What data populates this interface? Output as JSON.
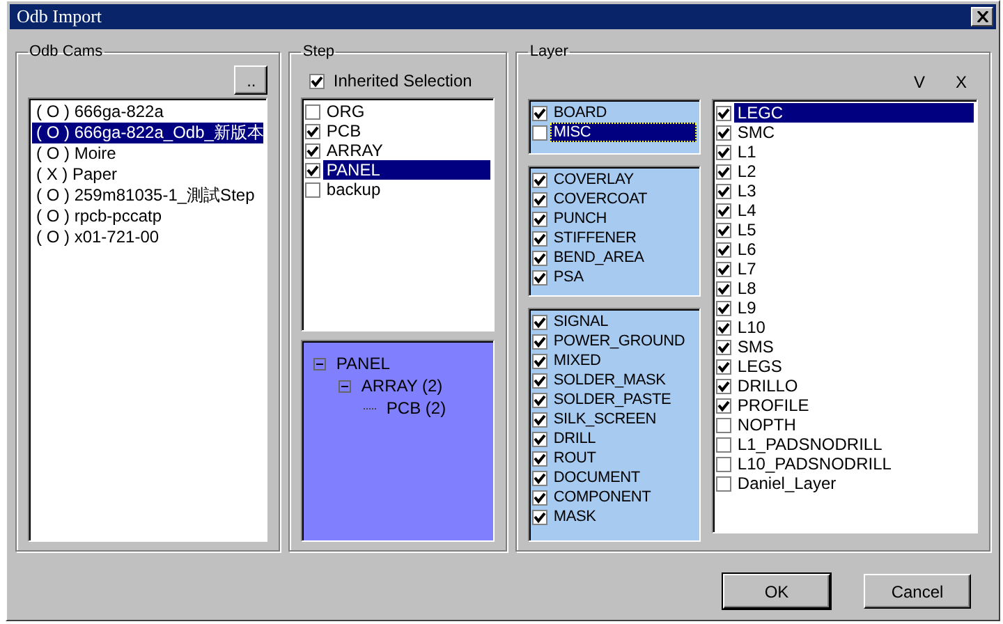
{
  "window": {
    "title": "Odb Import"
  },
  "odb_cams": {
    "title": "Odb Cams",
    "browse_button": "..",
    "items": [
      {
        "label": "( O ) 666ga-822a",
        "selected": false
      },
      {
        "label": "( O ) 666ga-822a_Odb_新版本",
        "selected": true
      },
      {
        "label": "( O ) Moire",
        "selected": false
      },
      {
        "label": "( X ) Paper",
        "selected": false
      },
      {
        "label": "( O ) 259m81035-1_測試Step",
        "selected": false
      },
      {
        "label": "( O ) rpcb-pccatp",
        "selected": false
      },
      {
        "label": "( O ) x01-721-00",
        "selected": false
      }
    ]
  },
  "step": {
    "title": "Step",
    "inherited_selection": {
      "label": "Inherited Selection",
      "checked": true
    },
    "items": [
      {
        "label": "ORG",
        "checked": false,
        "selected": false
      },
      {
        "label": "PCB",
        "checked": true,
        "selected": false
      },
      {
        "label": "ARRAY",
        "checked": true,
        "selected": false
      },
      {
        "label": "PANEL",
        "checked": true,
        "selected": true
      },
      {
        "label": "backup",
        "checked": false,
        "selected": false
      }
    ],
    "tree": [
      {
        "label": "PANEL",
        "expanded": true,
        "children": [
          {
            "label": "ARRAY (2)",
            "expanded": true,
            "children": [
              {
                "label": "PCB (2)"
              }
            ]
          }
        ]
      }
    ]
  },
  "layer": {
    "title": "Layer",
    "column_v": "V",
    "column_x": "X",
    "groups": [
      {
        "items": [
          {
            "label": "BOARD",
            "checked": true,
            "selected": false
          },
          {
            "label": "MISC",
            "checked": false,
            "selected": true
          }
        ]
      },
      {
        "items": [
          {
            "label": "COVERLAY",
            "checked": true,
            "selected": false
          },
          {
            "label": "COVERCOAT",
            "checked": true,
            "selected": false
          },
          {
            "label": "PUNCH",
            "checked": true,
            "selected": false
          },
          {
            "label": "STIFFENER",
            "checked": true,
            "selected": false
          },
          {
            "label": "BEND_AREA",
            "checked": true,
            "selected": false
          },
          {
            "label": "PSA",
            "checked": true,
            "selected": false
          }
        ]
      },
      {
        "items": [
          {
            "label": "SIGNAL",
            "checked": true,
            "selected": false
          },
          {
            "label": "POWER_GROUND",
            "checked": true,
            "selected": false
          },
          {
            "label": "MIXED",
            "checked": true,
            "selected": false
          },
          {
            "label": "SOLDER_MASK",
            "checked": true,
            "selected": false
          },
          {
            "label": "SOLDER_PASTE",
            "checked": true,
            "selected": false
          },
          {
            "label": "SILK_SCREEN",
            "checked": true,
            "selected": false
          },
          {
            "label": "DRILL",
            "checked": true,
            "selected": false
          },
          {
            "label": "ROUT",
            "checked": true,
            "selected": false
          },
          {
            "label": "DOCUMENT",
            "checked": true,
            "selected": false
          },
          {
            "label": "COMPONENT",
            "checked": true,
            "selected": false
          },
          {
            "label": "MASK",
            "checked": true,
            "selected": false
          }
        ]
      }
    ],
    "layers": [
      {
        "label": "LEGC",
        "checked": true,
        "selected": true
      },
      {
        "label": "SMC",
        "checked": true,
        "selected": false
      },
      {
        "label": "L1",
        "checked": true,
        "selected": false
      },
      {
        "label": "L2",
        "checked": true,
        "selected": false
      },
      {
        "label": "L3",
        "checked": true,
        "selected": false
      },
      {
        "label": "L4",
        "checked": true,
        "selected": false
      },
      {
        "label": "L5",
        "checked": true,
        "selected": false
      },
      {
        "label": "L6",
        "checked": true,
        "selected": false
      },
      {
        "label": "L7",
        "checked": true,
        "selected": false
      },
      {
        "label": "L8",
        "checked": true,
        "selected": false
      },
      {
        "label": "L9",
        "checked": true,
        "selected": false
      },
      {
        "label": "L10",
        "checked": true,
        "selected": false
      },
      {
        "label": "SMS",
        "checked": true,
        "selected": false
      },
      {
        "label": "LEGS",
        "checked": true,
        "selected": false
      },
      {
        "label": "DRILLO",
        "checked": true,
        "selected": false
      },
      {
        "label": "PROFILE",
        "checked": true,
        "selected": false
      },
      {
        "label": "NOPTH",
        "checked": false,
        "selected": false
      },
      {
        "label": "L1_PADSNODRILL",
        "checked": false,
        "selected": false
      },
      {
        "label": "L10_PADSNODRILL",
        "checked": false,
        "selected": false
      },
      {
        "label": "Daniel_Layer",
        "checked": false,
        "selected": false
      }
    ]
  },
  "buttons": [
    "OK",
    "Cancel"
  ]
}
